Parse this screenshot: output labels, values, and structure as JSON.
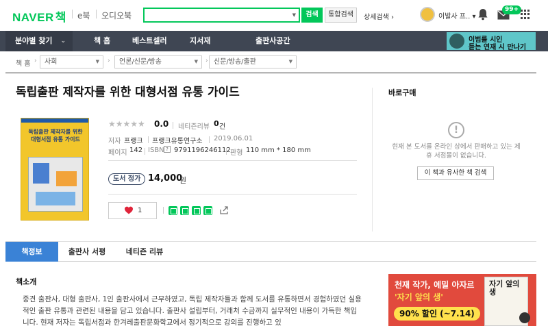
{
  "header": {
    "logo": "NAVER",
    "logo_sub": "책",
    "services": [
      "e북",
      "오디오북"
    ],
    "search": {
      "value": "",
      "placeholder": ""
    },
    "search_button": "검색",
    "integrated_button": "통합검색",
    "advanced_link": "상세검색 ›",
    "user_name": "이발사 프.. ▾",
    "mail_badge": "99+"
  },
  "nav": {
    "items": [
      "분야별 찾기",
      "책 홈",
      "베스트셀러",
      "지서재",
      "출판사공간"
    ],
    "banner_line1": "이범를 시인",
    "banner_line2": "듣는 연재 시 만나기"
  },
  "breadcrumb": {
    "home": "책 홈",
    "levels": [
      "사회",
      "언론/신문/방송",
      "신문/방송/출판"
    ]
  },
  "book": {
    "title": "독립출판 제작자를 위한 대형서점 유통 가이드",
    "cover_title": "독립출판 제작자를 위한 대형서점 유통 가이드",
    "rating_stars": 0,
    "rating": "0.0",
    "review_label": "네티즌리뷰",
    "review_count": "0",
    "review_unit": "건",
    "author_label": "저자",
    "author": "프랭크",
    "publisher": "프랭크유통연구소",
    "date": "2019.06.01",
    "pages_label": "페이지",
    "pages": "142",
    "isbn_label": "ISBN",
    "isbn": "9791196246112",
    "size_label": "판형",
    "size": "110 mm * 180 mm",
    "price_tag": "도서 정가",
    "price": "14,000",
    "price_unit": "원",
    "likes": "1"
  },
  "purchase": {
    "title": "바로구매",
    "message": "현재 본 도서를 온라인 상에서 판매하고 있는 제휴 서점몰이 없습니다.",
    "similar_button": "이 책과 유사한 책 검색"
  },
  "tabs": [
    "책정보",
    "출판사 서평",
    "네티즌 리뷰"
  ],
  "intro": {
    "title": "책소개",
    "text": "중견 출판사, 대형 출판사, 1인 출판사에서 근무하였고, 독립 제작자들과 함께 도서를 유통하면서 경험하였던 실용적인 출판 유통과 관련된 내용을 담고 있습니다. 출판사 설립부터, 거래처 수금까지 실무적인 내용이 가득한 책입니다. 현재 저자는 독립서점과 한겨레출판문화학교에서 정기적으로 강의를 진행하고 있"
  },
  "ad": {
    "line1": "천재 작가, 에밀 아자르",
    "line2": "'자기 앞의 생'",
    "line3": "90% 할인 (~7.14)",
    "book_title": "자기 앞의 생"
  },
  "colors": {
    "brand": "#03c75a",
    "nav_bg": "#3f4653",
    "tab_active": "#3a82d6",
    "ad_bg": "#e14a3d",
    "cover": "#f2c62b"
  }
}
